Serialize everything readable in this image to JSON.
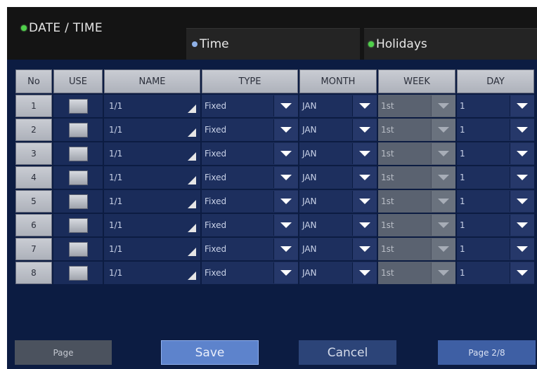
{
  "header": {
    "title": "DATE / TIME",
    "tabs": [
      {
        "label": "Time"
      },
      {
        "label": "Holidays"
      }
    ]
  },
  "table": {
    "columns": [
      "No",
      "USE",
      "NAME",
      "TYPE",
      "MONTH",
      "WEEK",
      "DAY"
    ],
    "rows": [
      {
        "no": "1",
        "name": "1/1",
        "type": "Fixed",
        "month": "JAN",
        "week": "1st",
        "day": "1"
      },
      {
        "no": "2",
        "name": "1/1",
        "type": "Fixed",
        "month": "JAN",
        "week": "1st",
        "day": "1"
      },
      {
        "no": "3",
        "name": "1/1",
        "type": "Fixed",
        "month": "JAN",
        "week": "1st",
        "day": "1"
      },
      {
        "no": "4",
        "name": "1/1",
        "type": "Fixed",
        "month": "JAN",
        "week": "1st",
        "day": "1"
      },
      {
        "no": "5",
        "name": "1/1",
        "type": "Fixed",
        "month": "JAN",
        "week": "1st",
        "day": "1"
      },
      {
        "no": "6",
        "name": "1/1",
        "type": "Fixed",
        "month": "JAN",
        "week": "1st",
        "day": "1"
      },
      {
        "no": "7",
        "name": "1/1",
        "type": "Fixed",
        "month": "JAN",
        "week": "1st",
        "day": "1"
      },
      {
        "no": "8",
        "name": "1/1",
        "type": "Fixed",
        "month": "JAN",
        "week": "1st",
        "day": "1"
      }
    ]
  },
  "footer": {
    "page_label": "Page",
    "save_label": "Save",
    "cancel_label": "Cancel",
    "page_indicator": "Page 2/8"
  },
  "icons": {
    "tab_active": "green-dot-icon",
    "tab_inactive": "blue-dot-icon",
    "dropdown": "chevron-down-icon",
    "edit": "corner-edit-icon"
  },
  "colors": {
    "panel": "#0c1c42",
    "tab": "#242424",
    "active_dot": "#4fd14a",
    "save": "#5d83cc",
    "cancel": "#2c4478"
  }
}
